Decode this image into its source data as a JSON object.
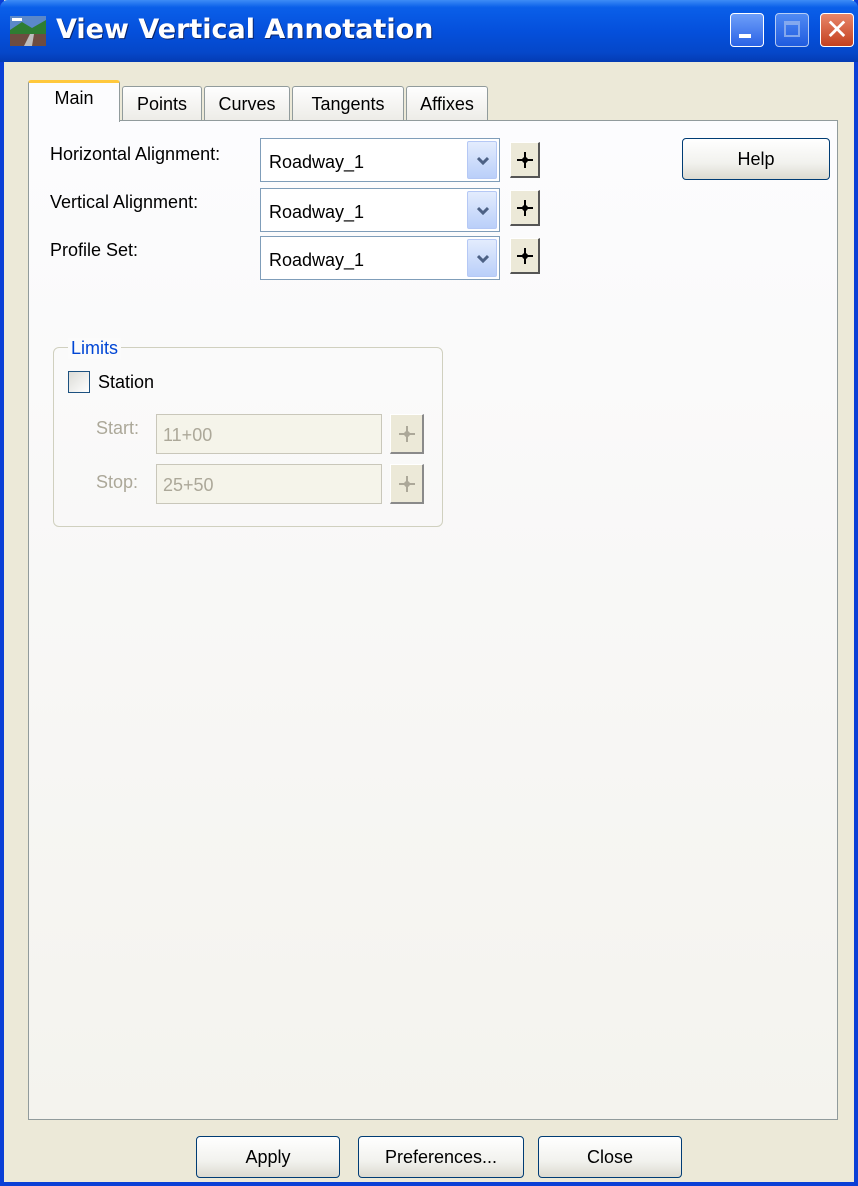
{
  "window": {
    "title": "View Vertical Annotation"
  },
  "tabs": [
    {
      "label": "Main",
      "selected": true
    },
    {
      "label": "Points",
      "selected": false
    },
    {
      "label": "Curves",
      "selected": false
    },
    {
      "label": "Tangents",
      "selected": false
    },
    {
      "label": "Affixes",
      "selected": false
    }
  ],
  "main": {
    "horizontal_alignment": {
      "label": "Horizontal Alignment:",
      "value": "Roadway_1"
    },
    "vertical_alignment": {
      "label": "Vertical Alignment:",
      "value": "Roadway_1"
    },
    "profile_set": {
      "label": "Profile Set:",
      "value": "Roadway_1"
    },
    "help_label": "Help",
    "limits": {
      "title": "Limits",
      "station_label": "Station",
      "station_checked": false,
      "start_label": "Start:",
      "start_value": "11+00",
      "stop_label": "Stop:",
      "stop_value": "25+50"
    }
  },
  "footer": {
    "apply_label": "Apply",
    "preferences_label": "Preferences...",
    "close_label": "Close"
  },
  "colors": {
    "titlebar": "#0550dc",
    "group_title": "#0046d5",
    "tab_highlight": "#ffc83c"
  }
}
